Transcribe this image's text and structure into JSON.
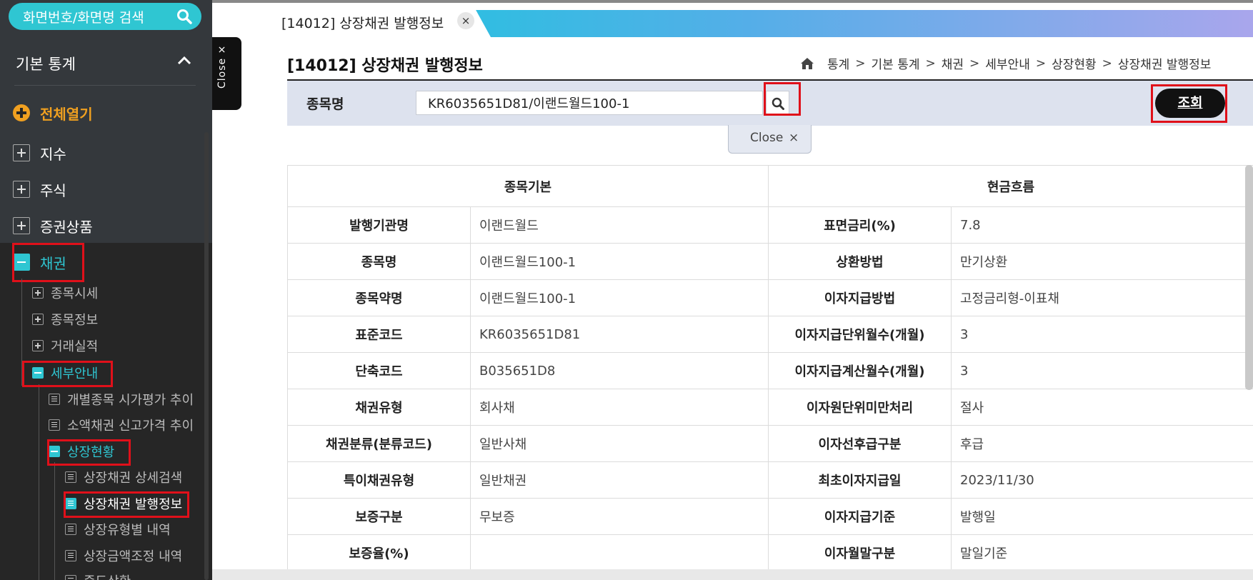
{
  "sidebar": {
    "search_placeholder": "화면번호/화면명 검색",
    "section_title": "기본 통계",
    "expand_all": "전체열기",
    "items": [
      {
        "label": "지수"
      },
      {
        "label": "주식"
      },
      {
        "label": "증권상품"
      },
      {
        "label": "채권"
      }
    ],
    "bond_children": [
      "종목시세",
      "종목정보",
      "거래실적",
      "세부안내"
    ],
    "detail_children": [
      "개별종목 시가평가 추이",
      "소액채권 신고가격 추이",
      "상장현황"
    ],
    "listing_children": [
      "상장채권 상세검색",
      "상장채권 발행정보",
      "상장유형별 내역",
      "상장금액조정 내역",
      "중도상환"
    ]
  },
  "close_tab_label": "Close ×",
  "tab": {
    "label": "[14012] 상장채권 발행정보",
    "close": "×"
  },
  "page": {
    "title": "[14012] 상장채권 발행정보",
    "breadcrumb": [
      "통계",
      "기본 통계",
      "채권",
      "세부안내",
      "상장현황",
      "상장채권 발행정보"
    ]
  },
  "search": {
    "label": "종목명",
    "value": "KR6035651D81/이랜드월드100-1",
    "query_button": "조회",
    "close_label": "Close",
    "close_x": "×"
  },
  "table": {
    "headers": [
      "종목기본",
      "현금흐름"
    ],
    "rows": [
      {
        "l1": "발행기관명",
        "v1": "이랜드월드",
        "l2": "표면금리(%)",
        "v2": "7.8"
      },
      {
        "l1": "종목명",
        "v1": "이랜드월드100-1",
        "l2": "상환방법",
        "v2": "만기상환"
      },
      {
        "l1": "종목약명",
        "v1": "이랜드월드100-1",
        "l2": "이자지급방법",
        "v2": "고정금리형-이표채"
      },
      {
        "l1": "표준코드",
        "v1": "KR6035651D81",
        "l2": "이자지급단위월수(개월)",
        "v2": "3"
      },
      {
        "l1": "단축코드",
        "v1": "B035651D8",
        "l2": "이자지급계산월수(개월)",
        "v2": "3"
      },
      {
        "l1": "채권유형",
        "v1": "회사채",
        "l2": "이자원단위미만처리",
        "v2": "절사"
      },
      {
        "l1": "채권분류(분류코드)",
        "v1": "일반사채",
        "l2": "이자선후급구분",
        "v2": "후급"
      },
      {
        "l1": "특이채권유형",
        "v1": "일반채권",
        "l2": "최초이자지급일",
        "v2": "2023/11/30"
      },
      {
        "l1": "보증구분",
        "v1": "무보증",
        "l2": "이자지급기준",
        "v2": "발행일"
      },
      {
        "l1": "보증율(%)",
        "v1": "",
        "l2": "이자월말구분",
        "v2": "말일기준"
      }
    ]
  },
  "colors": {
    "accent": "#2fc6d2",
    "highlight": "#e0101a",
    "orange": "#f0a020"
  }
}
